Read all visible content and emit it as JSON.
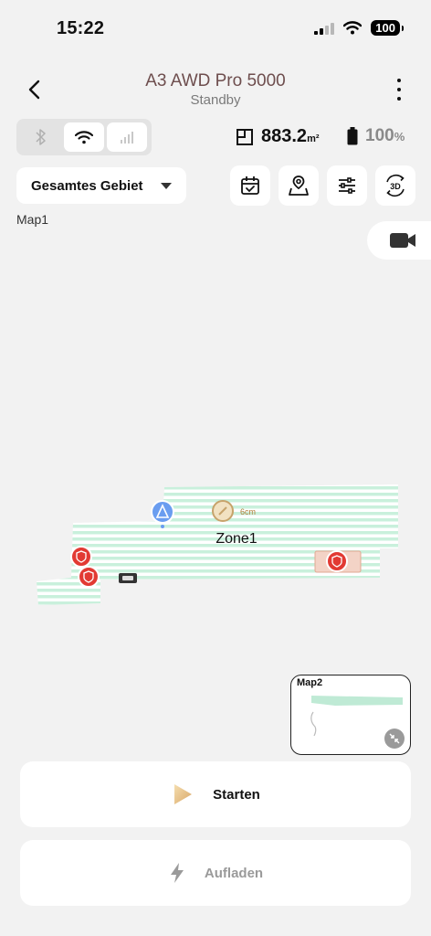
{
  "status_bar": {
    "time": "15:22",
    "battery": "100"
  },
  "header": {
    "title": "A3 AWD Pro 5000",
    "subtitle": "Standby"
  },
  "connection": {
    "icons": [
      "bluetooth-icon",
      "wifi-icon",
      "cellular-icon"
    ],
    "active": "wifi"
  },
  "stats": {
    "area_value": "883.2",
    "area_unit": "m²",
    "battery_value": "100",
    "battery_unit": "%"
  },
  "area_select": {
    "label": "Gesamtes Gebiet"
  },
  "toolbar": {
    "icons": [
      "calendar-check-icon",
      "map-edit-icon",
      "sliders-icon",
      "view-3d-icon"
    ],
    "view_3d_label": "3D"
  },
  "map": {
    "name": "Map1",
    "zone_label": "Zone1",
    "cut_height": "6cm",
    "colors": {
      "stripe": "#c9f0dc",
      "stripe_bg": "#ffffff",
      "no_go": "#e23a33",
      "station": "#6a9df0",
      "height_badge": "#c7a36b",
      "label_area": "#f3d3c6"
    }
  },
  "minimap": {
    "name": "Map2"
  },
  "actions": {
    "start_label": "Starten",
    "charge_label": "Aufladen"
  }
}
